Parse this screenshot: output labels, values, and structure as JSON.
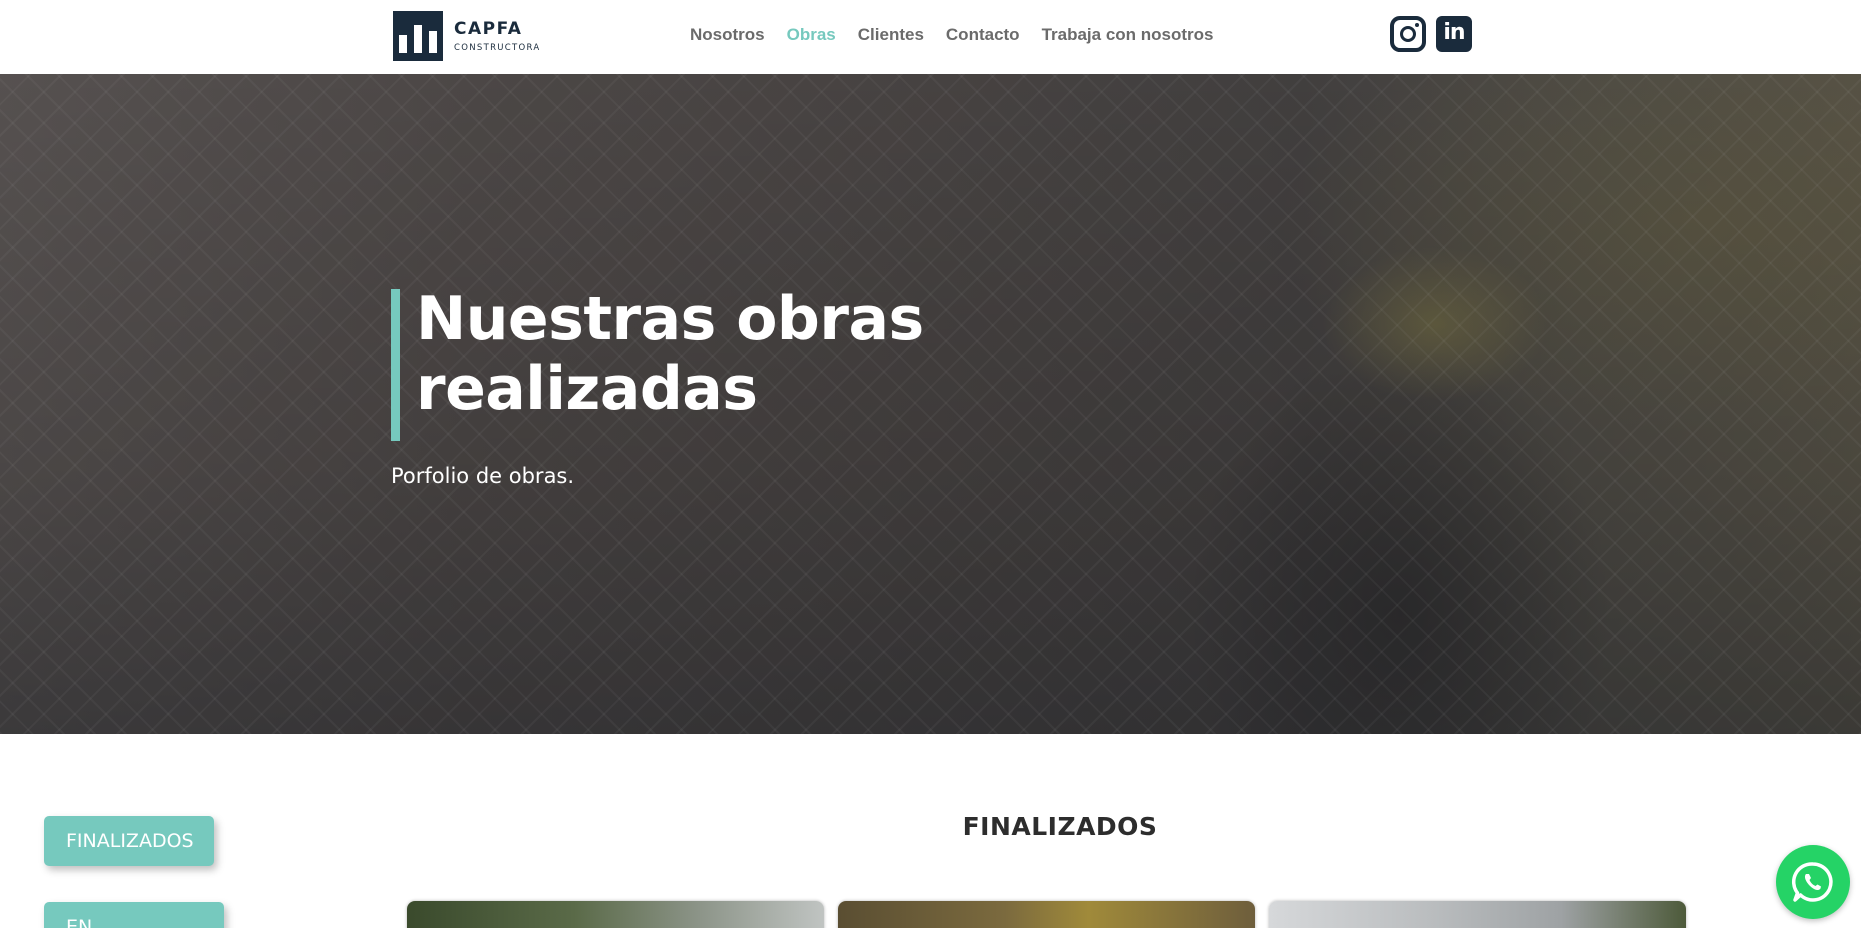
{
  "header": {
    "logo": {
      "title": "CAPFA",
      "subtitle": "CONSTRUCTORA"
    },
    "nav": [
      {
        "label": "Nosotros",
        "active": false
      },
      {
        "label": "Obras",
        "active": true
      },
      {
        "label": "Clientes",
        "active": false
      },
      {
        "label": "Contacto",
        "active": false
      },
      {
        "label": "Trabaja con nosotros",
        "active": false
      }
    ],
    "social": {
      "instagram_icon": "instagram-icon",
      "linkedin_icon": "linkedin-icon",
      "linkedin_glyph": "in"
    }
  },
  "hero": {
    "title": "Nuestras obras realizadas",
    "subtitle": "Porfolio de obras."
  },
  "filters": [
    {
      "label": "FINALIZADOS"
    },
    {
      "label": "EN EJECUCIÓN"
    }
  ],
  "section": {
    "title": "FINALIZADOS"
  },
  "floating": {
    "icon": "whatsapp-icon"
  },
  "colors": {
    "accent": "#76c9be",
    "brand_dark": "#1a2b3c",
    "nav_text": "#6b6b6b",
    "whatsapp": "#25d366"
  }
}
